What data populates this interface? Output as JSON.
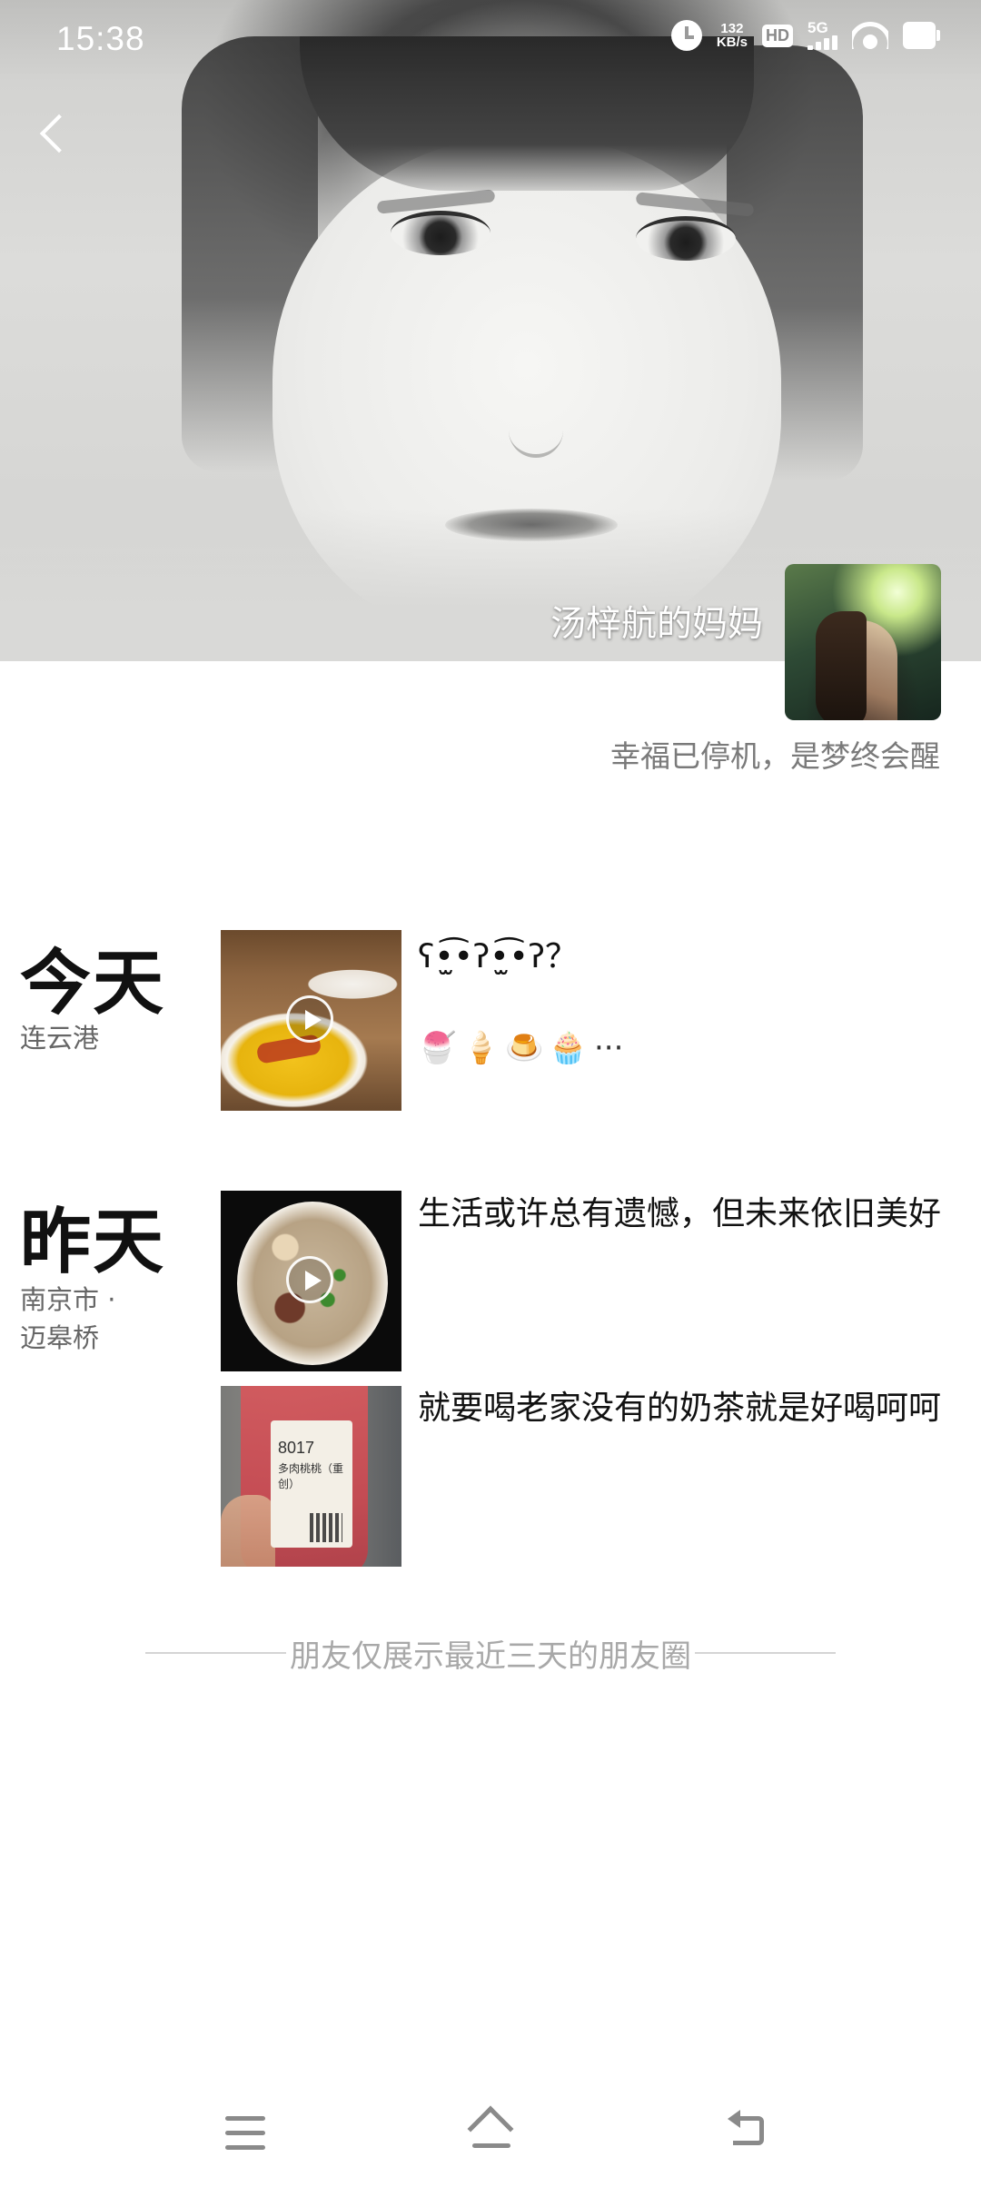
{
  "status_bar": {
    "time": "15:38",
    "net_speed_value": "132",
    "net_speed_unit": "KB/s",
    "hd_label": "HD",
    "network_label": "5G",
    "icons": [
      "alarm-icon",
      "hd-icon",
      "signal-icon",
      "wifi-icon",
      "battery-icon"
    ]
  },
  "profile": {
    "name": "汤梓航的妈妈",
    "signature": "幸福已停机，是梦终会醒",
    "cover_description_icon": "pencil-sketch-portrait",
    "avatar_icon": "avatar-photo"
  },
  "feed": {
    "today": {
      "day_label": "今天",
      "location": "连云港",
      "posts": [
        {
          "text": "ʕ•̫͡•ʔ•̫͡•ʔ？",
          "emoji_line": [
            "🍧",
            "🍦",
            "🍮",
            "🧁"
          ],
          "ellipsis": "···",
          "media": "video"
        }
      ]
    },
    "yesterday": {
      "day_label": "昨天",
      "location_line1": "南京市 ·",
      "location_line2": "迈皋桥",
      "posts": [
        {
          "text": "生活或许总有遗憾，但未来依旧美好",
          "media": "video"
        },
        {
          "text": "就要喝老家没有的奶茶就是好喝呵呵",
          "media": "photo"
        }
      ]
    }
  },
  "footer_note": "朋友仅展示最近三天的朋友圈",
  "drink_label": {
    "number": "8017",
    "name": "多肉桃桃（重创）"
  },
  "colors": {
    "background": "#ffffff",
    "primary_text": "#111111",
    "secondary_text": "#666666",
    "signature_text": "#7a7a7a",
    "footer_text": "#a8a8a8",
    "nav_icon": "#8a8a8a"
  }
}
